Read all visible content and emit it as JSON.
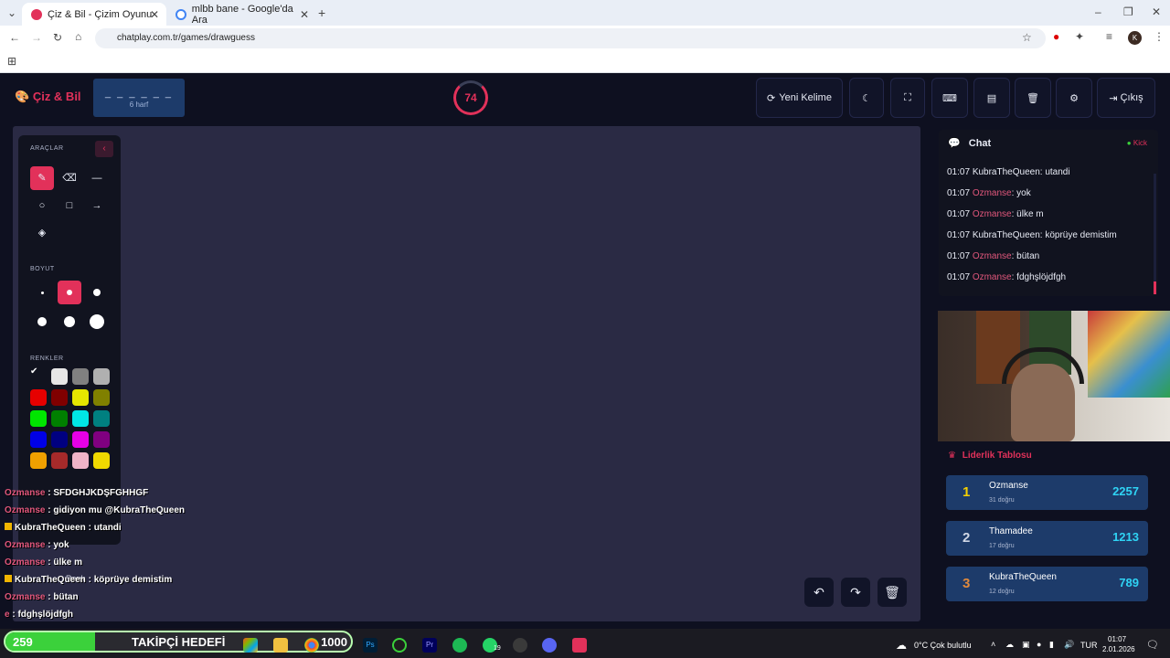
{
  "browser": {
    "tabs": [
      {
        "title": "Çiz & Bil - Çizim Oyunu",
        "active": true
      },
      {
        "title": "mlbb bane - Google'da Ara",
        "active": false
      }
    ],
    "url": "chatplay.com.tr/games/drawguess",
    "profile_initial": "K"
  },
  "header": {
    "logo": "Çiz & Bil",
    "word_mask": "_ _ _ _ _ _",
    "word_length": "6 harf",
    "timer": "74",
    "buttons": {
      "new_word": "Yeni Kelime",
      "exit": "Çıkış"
    }
  },
  "toolbox": {
    "tools_title": "ARAÇLAR",
    "size_title": "BOYUT",
    "colors_title": "RENKLER",
    "color_label": "Renk",
    "colors": [
      "#ffffff",
      "#e6e6e6",
      "#808080",
      "#b0b0b0",
      "#e60000",
      "#800000",
      "#e6e600",
      "#808000",
      "#00e600",
      "#008000",
      "#00e6e6",
      "#008080",
      "#0000e6",
      "#000080",
      "#e600e6",
      "#800080",
      "#f0a000",
      "#a52a2a",
      "#f0b4c8",
      "#f0d800"
    ]
  },
  "chat": {
    "title": "Chat",
    "kick_label": "Kick",
    "messages": [
      {
        "time": "01:07",
        "user": "KubraTheQueen",
        "text": "utandi",
        "color": "#e8ebf5"
      },
      {
        "time": "01:07",
        "user": "Ozmanse",
        "text": "yok",
        "color": "#e2577c"
      },
      {
        "time": "01:07",
        "user": "Ozmanse",
        "text": "ülke m",
        "color": "#e2577c"
      },
      {
        "time": "01:07",
        "user": "KubraTheQueen",
        "text": "köprüye demistim",
        "color": "#e8ebf5"
      },
      {
        "time": "01:07",
        "user": "Ozmanse",
        "text": "bütan",
        "color": "#e2577c"
      },
      {
        "time": "01:07",
        "user": "Ozmanse",
        "text": "fdghşlöjdfgh",
        "color": "#e2577c"
      }
    ]
  },
  "leaderboard": {
    "title": "Liderlik Tablosu",
    "rows": [
      {
        "rank": "1",
        "name": "Ozmanse",
        "correct": "31 doğru",
        "score": "2257",
        "rank_color": "#f5d000"
      },
      {
        "rank": "2",
        "name": "Thamadee",
        "correct": "17 doğru",
        "score": "1213",
        "rank_color": "#cfd6e4"
      },
      {
        "rank": "3",
        "name": "KubraTheQueen",
        "correct": "12 doğru",
        "score": "789",
        "rank_color": "#e08a3c"
      }
    ]
  },
  "overlay_chat": [
    {
      "user": "Ozmanse",
      "text": "SFDGHJKDŞFGHHGF",
      "badge": false
    },
    {
      "user": "Ozmanse",
      "text": "gidiyon mu @KubraTheQueen",
      "badge": false
    },
    {
      "user": "KubraTheQueen",
      "text": "utandi",
      "badge": true
    },
    {
      "user": "Ozmanse",
      "text": "yok",
      "badge": false
    },
    {
      "user": "Ozmanse",
      "text": "ülke m",
      "badge": false
    },
    {
      "user": "KubraTheQueen",
      "text": "köprüye demistim",
      "badge": true
    },
    {
      "user": "Ozmanse",
      "text": "bütan",
      "badge": false
    },
    {
      "user": "e",
      "text": "fdghşlöjdfgh",
      "badge": false
    }
  ],
  "follow_goal": {
    "current": "259",
    "label": "TAKİPÇİ HEDEFİ",
    "goal": "1000",
    "progress": 0.259
  },
  "taskbar": {
    "weather": "0°C  Çok bulutlu",
    "lang": "TUR",
    "time": "01:07",
    "date": "2.01.2026",
    "whatsapp_badge": "19"
  }
}
